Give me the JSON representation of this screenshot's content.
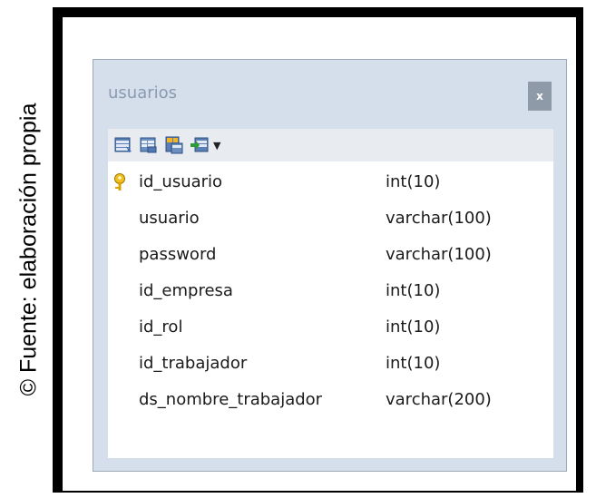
{
  "caption": "© Fuente: elaboración propia",
  "table": {
    "title": "usuarios",
    "close_label": "x",
    "toolbar_icons": [
      "table-properties-icon",
      "table-view-icon",
      "relations-icon",
      "export-icon"
    ],
    "toolbar_dropdown": "chevron-down-icon",
    "columns": [
      {
        "name": "id_usuario",
        "type": "int(10)",
        "primary_key": true
      },
      {
        "name": "usuario",
        "type": "varchar(100)",
        "primary_key": false
      },
      {
        "name": "password",
        "type": "varchar(100)",
        "primary_key": false
      },
      {
        "name": "id_empresa",
        "type": "int(10)",
        "primary_key": false
      },
      {
        "name": "id_rol",
        "type": "int(10)",
        "primary_key": false
      },
      {
        "name": "id_trabajador",
        "type": "int(10)",
        "primary_key": false
      },
      {
        "name": "ds_nombre_trabajador",
        "type": "varchar(200)",
        "primary_key": false
      }
    ]
  },
  "colors": {
    "panel_bg": "#d5dfec",
    "title_text": "#8a9aaf",
    "close_bg": "#8f9aa8",
    "key_icon": "#e0a800"
  }
}
